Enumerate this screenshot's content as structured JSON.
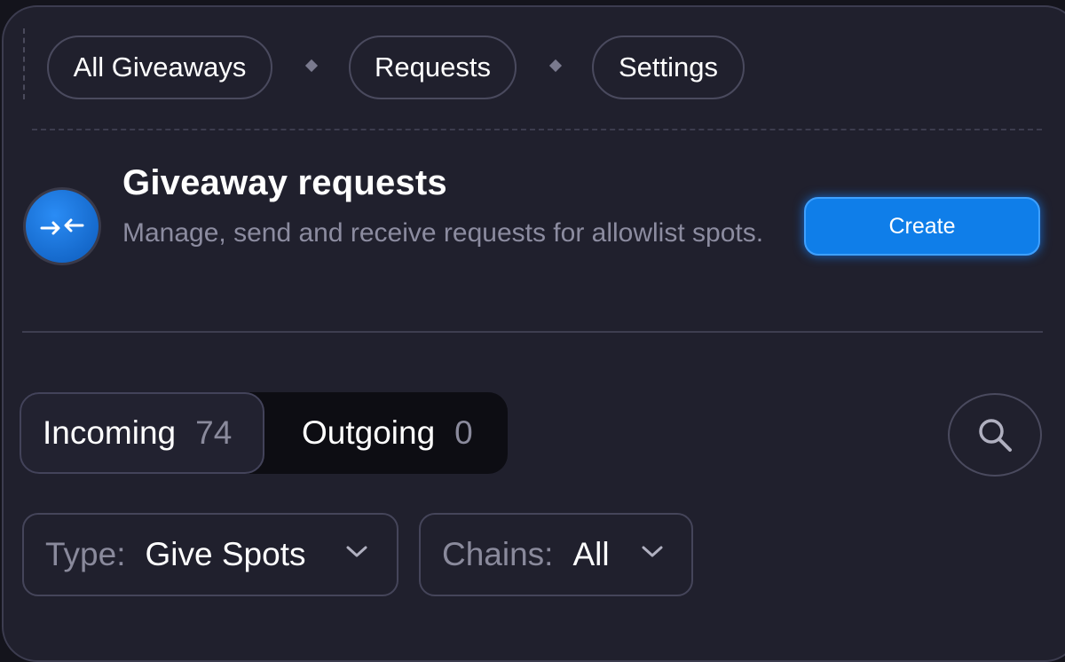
{
  "nav": {
    "items": [
      "All Giveaways",
      "Requests",
      "Settings"
    ]
  },
  "header": {
    "title": "Giveaway requests",
    "description": "Manage, send and receive requests for allowlist spots.",
    "create_label": "Create",
    "avatar_icon": "arrows-in-icon"
  },
  "tabs": [
    {
      "label": "Incoming",
      "count": "74",
      "active": true
    },
    {
      "label": "Outgoing",
      "count": "0",
      "active": false
    }
  ],
  "search": {
    "icon": "search-icon"
  },
  "filters": {
    "type": {
      "label": "Type:",
      "value": "Give Spots"
    },
    "chains": {
      "label": "Chains:",
      "value": "All"
    }
  },
  "colors": {
    "background": "#20202d",
    "accent": "#0f7ee9",
    "muted_text": "#8c8ca0"
  }
}
